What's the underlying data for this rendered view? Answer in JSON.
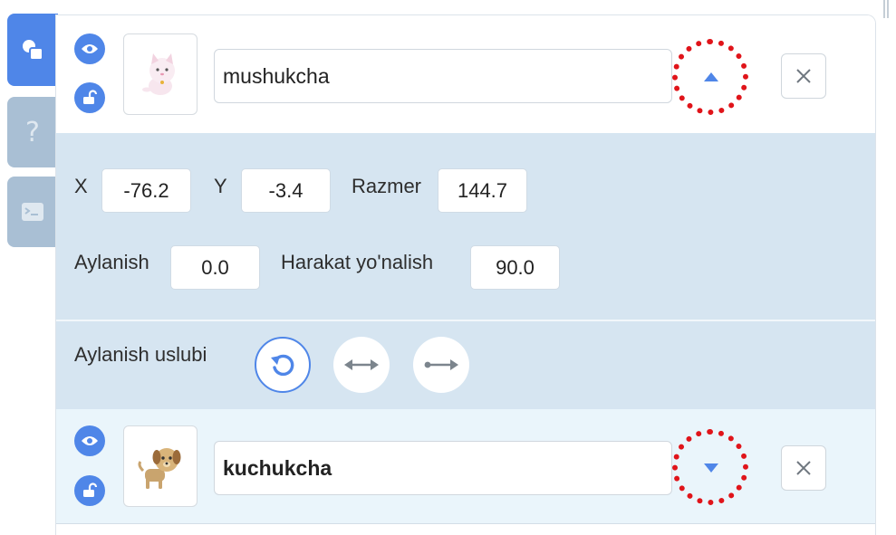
{
  "rail": {
    "tabs": [
      {
        "name": "sprite",
        "icon": "sprite-shapes-icon",
        "active": true
      },
      {
        "name": "help",
        "icon": "question-mark-icon",
        "label": "?",
        "active": false
      },
      {
        "name": "console",
        "icon": "console-icon",
        "active": false
      }
    ]
  },
  "sprites": [
    {
      "name": "mushukcha",
      "expanded": true,
      "toggle_icon": "triangle-up-icon"
    },
    {
      "name": "kuchukcha",
      "expanded": false,
      "toggle_icon": "triangle-down-icon"
    }
  ],
  "props": {
    "x_label": "X",
    "x_value": "-76.2",
    "y_label": "Y",
    "y_value": "-3.4",
    "size_label": "Razmer",
    "size_value": "144.7",
    "rotation_label": "Aylanish",
    "rotation_value": "0.0",
    "direction_label": "Harakat yo'nalish",
    "direction_value": "90.0",
    "rotation_style_label": "Aylanish uslubi"
  },
  "colors": {
    "accent": "#4f86e8",
    "highlight_ring": "#e0141a",
    "props_bg": "#d6e5f1",
    "row_bg_selected": "#eaf5fb",
    "rail_inactive": "#a9bfd4"
  }
}
